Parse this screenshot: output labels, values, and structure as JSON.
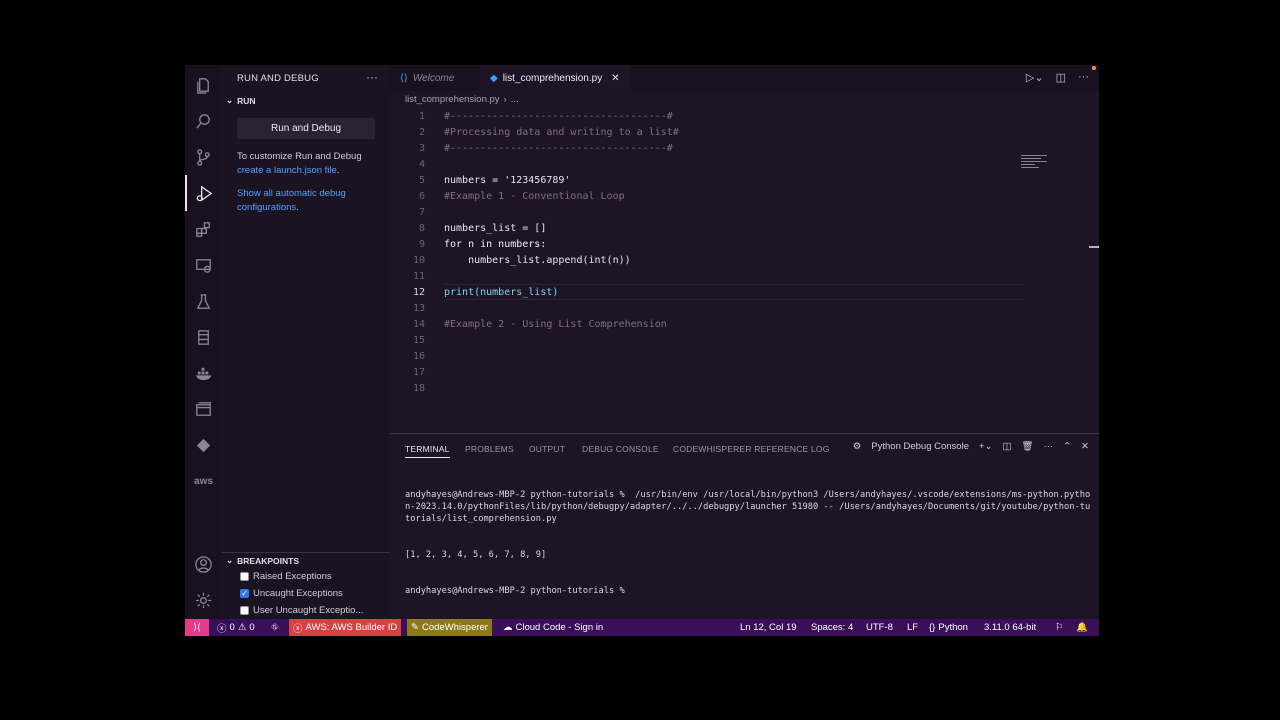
{
  "sidebar": {
    "title": "RUN AND DEBUG",
    "more_icon": "ellipsis-icon",
    "run_section": "RUN",
    "run_button": "Run and Debug",
    "customize_text": "To customize Run and Debug",
    "launch_link": "create a launch.json file",
    "launch_suffix": ".",
    "show_link_line1": "Show all automatic debug",
    "show_link_line2": "configurations",
    "show_suffix": ".",
    "breakpoints_section": "BREAKPOINTS",
    "breakpoints": [
      {
        "label": "Raised Exceptions",
        "checked": false
      },
      {
        "label": "Uncaught Exceptions",
        "checked": true
      },
      {
        "label": "User Uncaught Exceptio...",
        "checked": false
      }
    ]
  },
  "tabs": [
    {
      "label": "Welcome",
      "icon": "vscode-icon",
      "active": false
    },
    {
      "label": "list_comprehension.py",
      "icon": "python-icon",
      "active": true
    }
  ],
  "breadcrumb": {
    "file": "list_comprehension.py",
    "more": "..."
  },
  "editor": {
    "current_line": 12,
    "lines": [
      {
        "n": "1",
        "text": "#------------------------------------#"
      },
      {
        "n": "2",
        "text": "#Processing data and writing to a list#"
      },
      {
        "n": "3",
        "text": "#------------------------------------#"
      },
      {
        "n": "4",
        "text": ""
      },
      {
        "n": "5",
        "text": "numbers = '123456789'"
      },
      {
        "n": "6",
        "text": "#Example 1 - Conventional Loop"
      },
      {
        "n": "7",
        "text": ""
      },
      {
        "n": "8",
        "text": "numbers_list = []"
      },
      {
        "n": "9",
        "text": "for n in numbers:"
      },
      {
        "n": "10",
        "text": "    numbers_list.append(int(n))"
      },
      {
        "n": "11",
        "text": ""
      },
      {
        "n": "12",
        "text": "print(numbers_list)"
      },
      {
        "n": "13",
        "text": ""
      },
      {
        "n": "14",
        "text": "#Example 2 - Using List Comprehension"
      },
      {
        "n": "15",
        "text": ""
      },
      {
        "n": "16",
        "text": ""
      },
      {
        "n": "17",
        "text": ""
      },
      {
        "n": "18",
        "text": ""
      }
    ]
  },
  "panel": {
    "tabs": [
      "TERMINAL",
      "PROBLEMS",
      "OUTPUT",
      "DEBUG CONSOLE",
      "CODEWHISPERER REFERENCE LOG"
    ],
    "active_tab": "TERMINAL",
    "terminal_name": "Python Debug Console",
    "terminal_lines": [
      "andyhayes@Andrews-MBP-2 python-tutorials %  /usr/bin/env /usr/local/bin/python3 /Users/andyhayes/.vscode/extensions/ms-python.python-2023.14.0/pythonFiles/lib/python/debugpy/adapter/../../debugpy/launcher 51980 -- /Users/andyhayes/Documents/git/youtube/python-tutorials/list_comprehension.py",
      "[1, 2, 3, 4, 5, 6, 7, 8, 9]",
      "andyhayes@Andrews-MBP-2 python-tutorials %"
    ]
  },
  "status": {
    "errors": "0",
    "warnings": "0",
    "aws": "AWS: AWS Builder ID",
    "codewhisperer": "CodeWhisperer",
    "cloud_code": "Cloud Code - Sign in",
    "position": "Ln 12, Col 19",
    "spaces": "Spaces: 4",
    "encoding": "UTF-8",
    "eol": "LF",
    "language": "Python",
    "interpreter": "3.11.0 64-bit"
  },
  "colors": {
    "status_bar": "#3a0f5a",
    "remote": "#e63a8e",
    "aws": "#d94040",
    "codewhisperer": "#8c7a16",
    "link": "#4da3ff"
  }
}
